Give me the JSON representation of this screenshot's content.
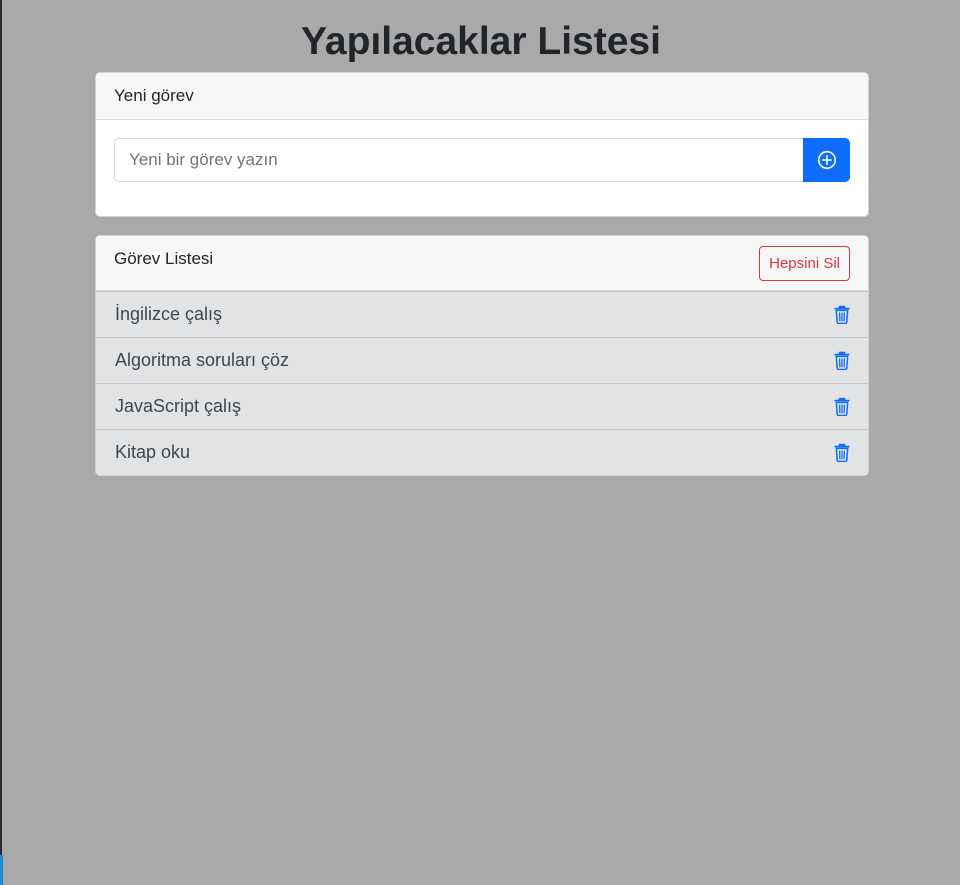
{
  "page": {
    "title": "Yapılacaklar Listesi"
  },
  "new_task_card": {
    "header": "Yeni görev",
    "input_placeholder": "Yeni bir görev yazın",
    "input_value": "",
    "add_button_icon": "plus-circle-icon"
  },
  "task_list_card": {
    "header": "Görev Listesi",
    "clear_all_label": "Hepsini Sil",
    "delete_icon": "trash-icon",
    "items": [
      {
        "label": "İngilizce çalış"
      },
      {
        "label": "Algoritma soruları çöz"
      },
      {
        "label": "JavaScript çalış"
      },
      {
        "label": "Kitap oku"
      }
    ]
  },
  "colors": {
    "background": "#a9a9a9",
    "primary": "#0d6efd",
    "danger": "#dc3545",
    "list_item_bg": "#e2e3e5"
  }
}
